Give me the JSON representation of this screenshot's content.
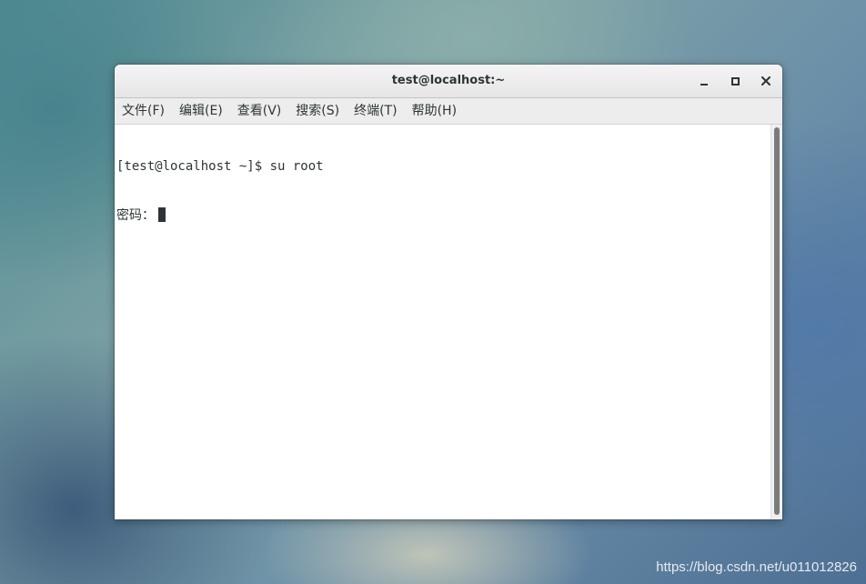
{
  "window": {
    "title": "test@localhost:~",
    "controls": {
      "minimize_icon": "minimize-icon",
      "maximize_icon": "maximize-icon",
      "close_icon": "close-icon"
    }
  },
  "menubar": {
    "items": [
      {
        "label": "文件(F)"
      },
      {
        "label": "编辑(E)"
      },
      {
        "label": "查看(V)"
      },
      {
        "label": "搜索(S)"
      },
      {
        "label": "终端(T)"
      },
      {
        "label": "帮助(H)"
      }
    ]
  },
  "terminal": {
    "lines": [
      "[test@localhost ~]$ su root",
      "密码："
    ],
    "cursor": "block"
  },
  "watermark": {
    "text": "https://blog.csdn.net/u011012826"
  },
  "colors": {
    "window_bg": "#ffffff",
    "titlebar_bg": "#ececec",
    "menubar_bg": "#ededed",
    "text": "#2e3436",
    "scroll_thumb": "#7b7b7b"
  }
}
